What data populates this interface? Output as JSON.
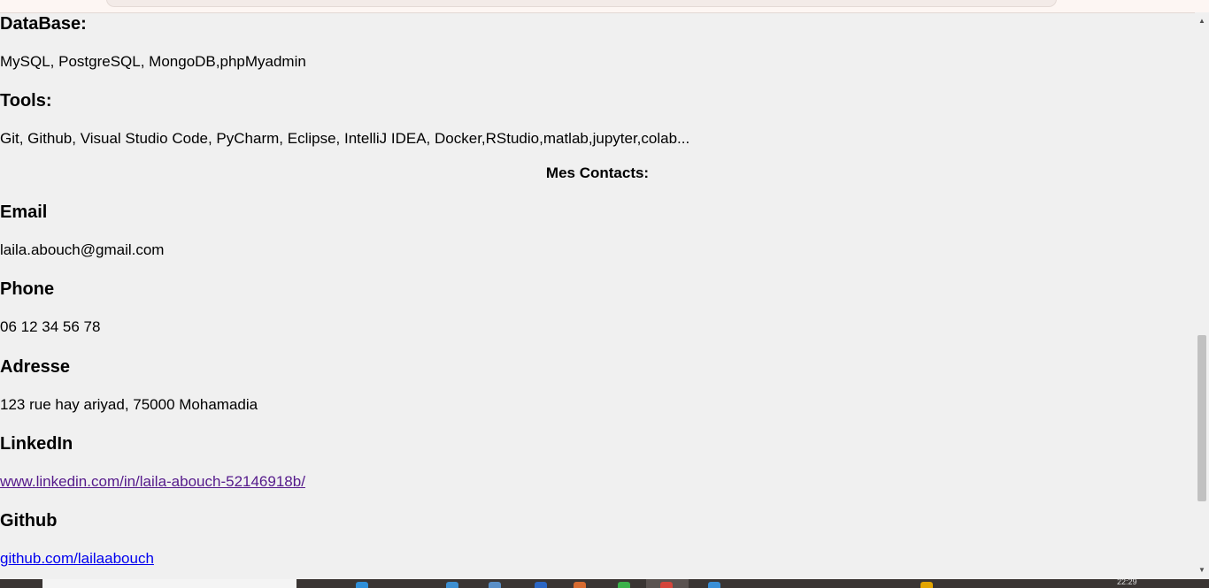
{
  "sections": {
    "database": {
      "heading": "DataBase:",
      "text": "MySQL, PostgreSQL, MongoDB,phpMyadmin"
    },
    "tools": {
      "heading": "Tools:",
      "text": "Git, Github, Visual Studio Code, PyCharm, Eclipse, IntelliJ IDEA, Docker,RStudio,matlab,jupyter,colab..."
    }
  },
  "contacts": {
    "title": "Mes Contacts:",
    "email": {
      "heading": "Email",
      "value": "laila.abouch@gmail.com"
    },
    "phone": {
      "heading": "Phone",
      "value": "06 12 34 56 78"
    },
    "address": {
      "heading": "Adresse",
      "value": "123 rue hay ariyad, 75000 Mohamadia"
    },
    "linkedin": {
      "heading": "LinkedIn",
      "value": "www.linkedin.com/in/laila-abouch-52146918b/"
    },
    "github": {
      "heading": "Github",
      "value": "github.com/lailaabouch"
    }
  },
  "taskbar": {
    "clock": "22:29"
  },
  "colors": {
    "background": "#f0f0f0",
    "visited_link": "#551a8b",
    "link": "#0000ee",
    "taskbar": "#3a3533"
  },
  "icons": {
    "scroll_up": "triangle-up",
    "scroll_down": "triangle-down"
  }
}
